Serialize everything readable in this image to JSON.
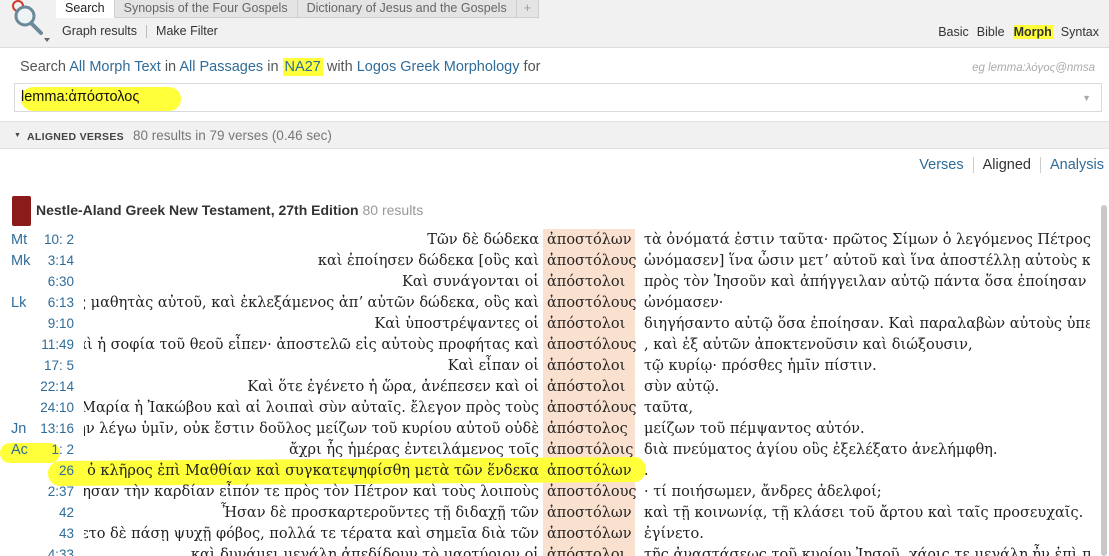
{
  "tabs": [
    {
      "label": "Search",
      "active": true
    },
    {
      "label": "Synopsis of the Four Gospels",
      "active": false
    },
    {
      "label": "Dictionary of Jesus and the Gospels",
      "active": false
    },
    {
      "label": "+",
      "active": false
    }
  ],
  "subtabs": [
    "Graph results",
    "Make Filter"
  ],
  "modes": [
    {
      "label": "Basic",
      "active": false
    },
    {
      "label": "Bible",
      "active": false
    },
    {
      "label": "Morph",
      "active": true
    },
    {
      "label": "Syntax",
      "active": false
    }
  ],
  "search": {
    "prefix": "Search",
    "scope_text": "All Morph Text",
    "in1": "in",
    "passages": "All Passages",
    "in2": "in",
    "version": "NA27",
    "with": "with",
    "morphology": "Logos Greek Morphology",
    "for": "for",
    "example": "eg lemma:λόγος@nmsa",
    "query": "lemma:ἀπόστολος"
  },
  "results": {
    "section_label": "ALIGNED VERSES",
    "count_text": "80 results in 79 verses (0.46 sec)"
  },
  "views": [
    "Verses",
    "Aligned",
    "Analysis"
  ],
  "book": {
    "title": "Nestle-Aland Greek New Testament, 27th Edition",
    "count": "80 results"
  },
  "rows": [
    {
      "book": "Mt",
      "ref": "10: 2",
      "before": "Τῶν δὲ δώδεκα",
      "kw": "ἀποστόλων",
      "after": "τὰ ὀνόματά ἐστιν ταῦτα· πρῶτος Σίμων ὁ λεγόμενος Πέτρος κα"
    },
    {
      "book": "Mk",
      "ref": "3:14",
      "before": "καὶ ἐποίησεν δώδεκα [οὓς καὶ",
      "kw": "ἀποστόλους",
      "after": "ὠνόμασεν] ἵνα ὦσιν μετʼ αὐτοῦ καὶ ἵνα ἀποστέλλῃ αὐτοὺς κηρύ"
    },
    {
      "book": "",
      "ref": "6:30",
      "before": "Καὶ συνάγονται οἱ",
      "kw": "ἀπόστολοι",
      "after": "πρὸς τὸν Ἰησοῦν καὶ ἀπήγγειλαν αὐτῷ πάντα ὅσα ἐποίησαν καὶ"
    },
    {
      "book": "Lk",
      "ref": "6:13",
      "before": "οὺς μαθητὰς αὐτοῦ, καὶ ἐκλεξάμενος ἀπʼ αὐτῶν δώδεκα, οὓς καὶ",
      "kw": "ἀποστόλους",
      "after": "ὠνόμασεν·"
    },
    {
      "book": "",
      "ref": "9:10",
      "before": "Καὶ ὑποστρέψαντες οἱ",
      "kw": "ἀπόστολοι",
      "after": "διηγήσαντο αὐτῷ ὅσα ἐποίησαν. Καὶ παραλαβὼν αὐτοὺς ὑπεχώ"
    },
    {
      "book": "",
      "ref": "11:49",
      "before": "καὶ ἡ σοφία τοῦ θεοῦ εἶπεν· ἀποστελῶ εἰς αὐτοὺς προφήτας καὶ",
      "kw": "ἀποστόλους",
      "after": ", καὶ ἐξ αὐτῶν ἀποκτενοῦσιν καὶ διώξουσιν,"
    },
    {
      "book": "",
      "ref": "17: 5",
      "before": "Καὶ εἶπαν οἱ",
      "kw": "ἀπόστολοι",
      "after": "τῷ κυρίῳ· πρόσθες ἡμῖν πίστιν."
    },
    {
      "book": "",
      "ref": "22:14",
      "before": "Καὶ ὅτε ἐγένετο ἡ ὥρα, ἀνέπεσεν καὶ οἱ",
      "kw": "ἀπόστολοι",
      "after": "σὺν αὐτῷ."
    },
    {
      "book": "",
      "ref": "24:10",
      "before": "καὶ Μαρία ἡ Ἰακώβου καὶ αἱ λοιπαὶ σὺν αὐταῖς. ἔλεγον πρὸς τοὺς",
      "kw": "ἀποστόλους",
      "after": "ταῦτα,"
    },
    {
      "book": "Jn",
      "ref": "13:16",
      "before": "μὴν λέγω ὑμῖν, οὐκ ἔστιν δοῦλος μείζων τοῦ κυρίου αὐτοῦ οὐδὲ",
      "kw": "ἀπόστολος",
      "after": "μείζων τοῦ πέμψαντος αὐτόν."
    },
    {
      "book": "Ac",
      "ref": "1: 2",
      "before": "ἄχρι ἧς ἡμέρας ἐντειλάμενος τοῖς",
      "kw": "ἀποστόλοις",
      "after": "διὰ πνεύματος ἁγίου οὓς ἐξελέξατο ἀνελήμφθη."
    },
    {
      "book": "",
      "ref": "26",
      "before": "εν ὁ κλῆρος ἐπὶ Μαθθίαν καὶ συγκατεψηφίσθη μετὰ τῶν ἕνδεκα",
      "kw": "ἀποστόλων",
      "after": "."
    },
    {
      "book": "",
      "ref": "2:37",
      "before": "ύγησαν τὴν καρδίαν εἶπόν τε πρὸς τὸν Πέτρον καὶ τοὺς λοιποὺς",
      "kw": "ἀποστόλους",
      "after": "· τί ποιήσωμεν, ἄνδρες ἀδελφοί;"
    },
    {
      "book": "",
      "ref": "42",
      "before": "Ἦσαν δὲ προσκαρτεροῦντες τῇ διδαχῇ τῶν",
      "kw": "ἀποστόλων",
      "after": "καὶ τῇ κοινωνίᾳ, τῇ κλάσει τοῦ ἄρτου καὶ ταῖς προσευχαῖς."
    },
    {
      "book": "",
      "ref": "43",
      "before": "ίνετο δὲ πάσῃ ψυχῇ φόβος, πολλά τε τέρατα καὶ σημεῖα διὰ τῶν",
      "kw": "ἀποστόλων",
      "after": "ἐγίνετο."
    },
    {
      "book": "",
      "ref": "4:33",
      "before": "καὶ δυνάμει μεγάλῃ ἀπεδίδουν τὸ μαρτύριον οἱ",
      "kw": "ἀπόστολοι",
      "after": "τῆς ἀναστάσεως τοῦ κυρίου Ἰησοῦ, χάρις τε μεγάλη ἦν ἐπὶ πάν"
    }
  ]
}
